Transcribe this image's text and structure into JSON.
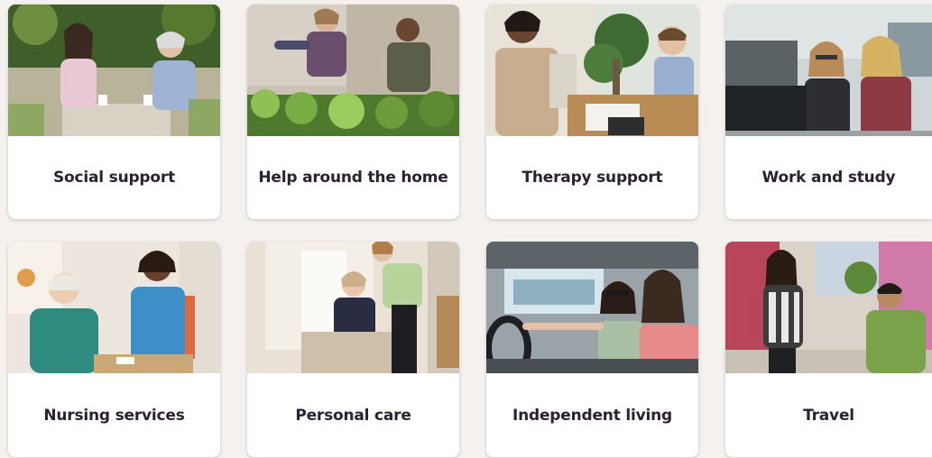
{
  "cards": [
    {
      "label": "Social support",
      "image": "two-women-chatting-outdoors"
    },
    {
      "label": "Help around the home",
      "image": "people-gardening"
    },
    {
      "label": "Therapy support",
      "image": "therapist-with-child"
    },
    {
      "label": "Work and study",
      "image": "women-at-office-computer"
    },
    {
      "label": "Nursing services",
      "image": "nurse-with-elderly-woman"
    },
    {
      "label": "Personal care",
      "image": "carer-helping-woman"
    },
    {
      "label": "Independent living",
      "image": "women-driving-car"
    },
    {
      "label": "Travel",
      "image": "friends-walking-street"
    }
  ]
}
